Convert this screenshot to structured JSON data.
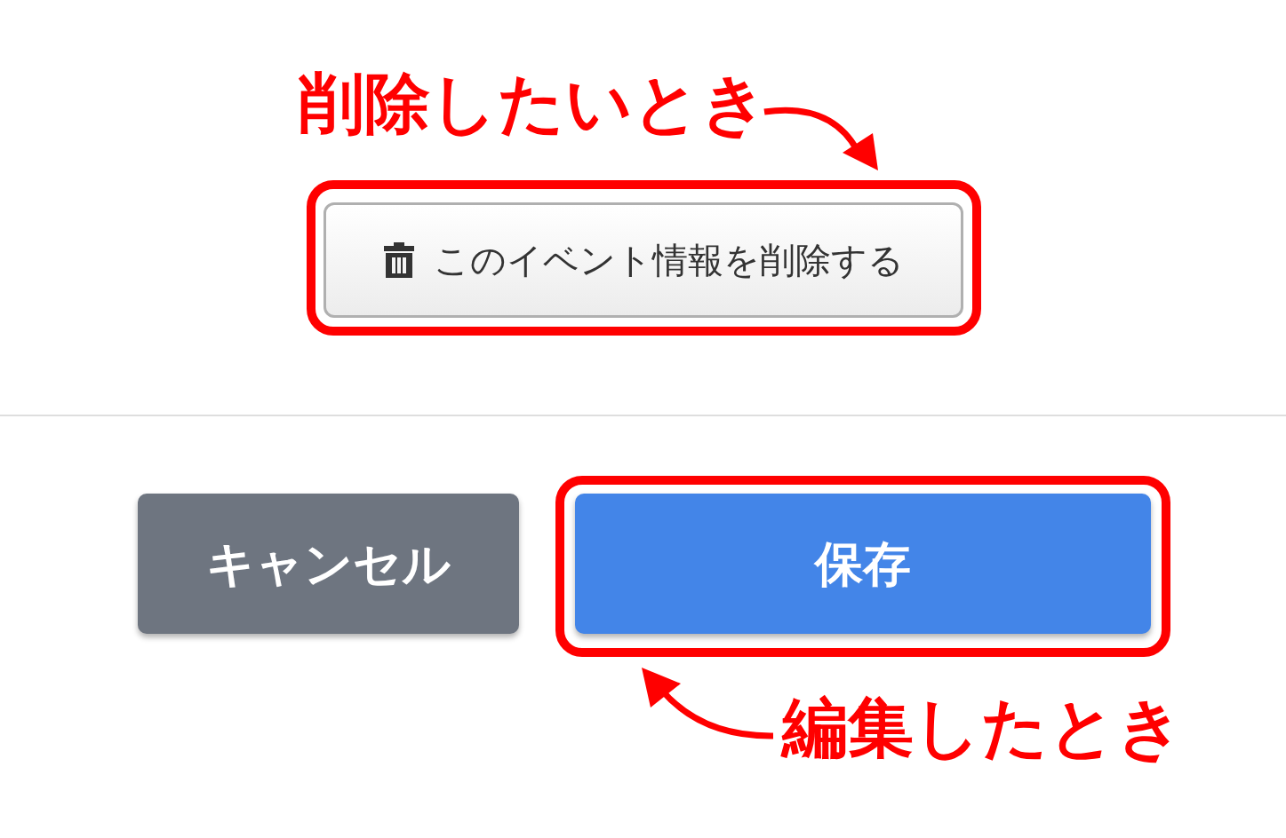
{
  "delete_button": {
    "label": "このイベント情報を削除する",
    "highlighted": true
  },
  "cancel_button": {
    "label": "キャンセル"
  },
  "save_button": {
    "label": "保存",
    "highlighted": true
  },
  "annotations": [
    {
      "text": "削除したいとき"
    },
    {
      "text": "編集したとき"
    }
  ]
}
